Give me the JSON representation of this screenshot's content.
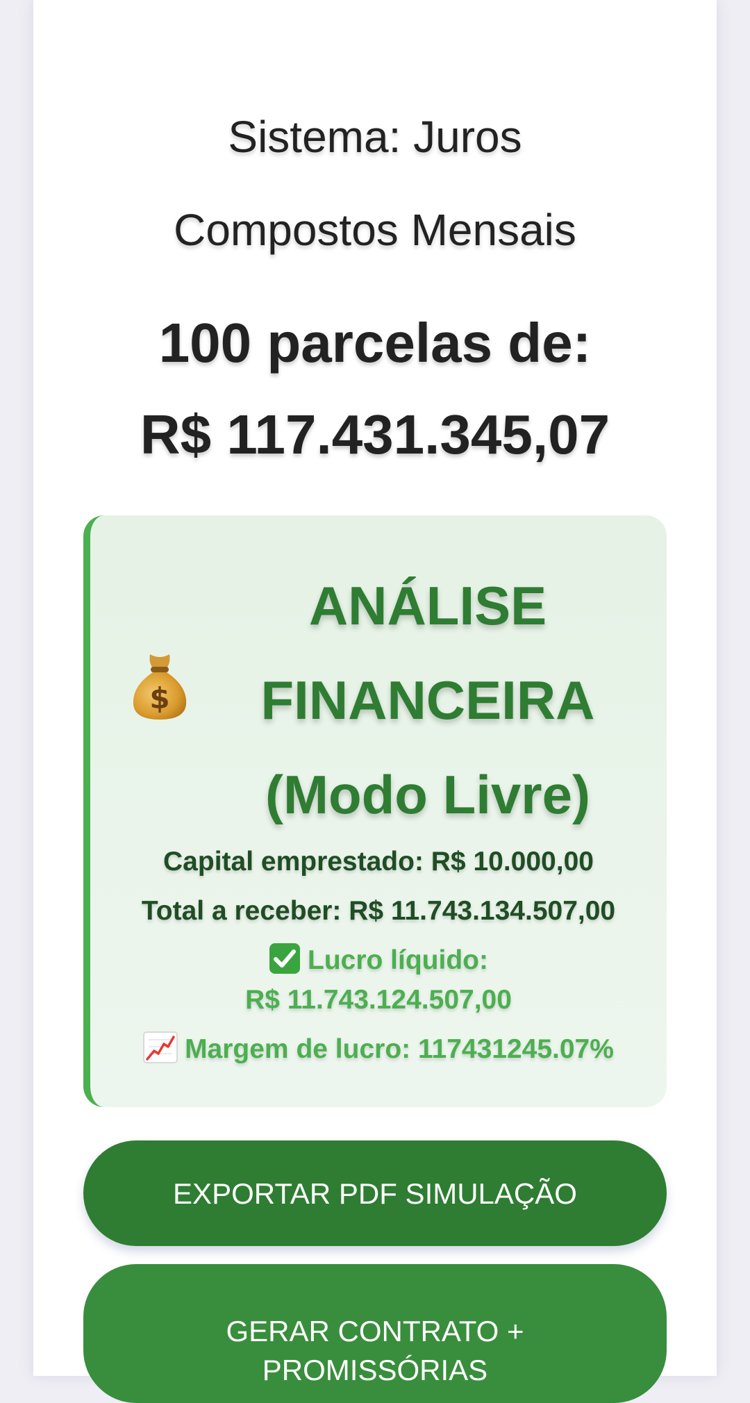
{
  "header": {
    "system_line1": "Sistema: Juros",
    "system_line2": "Compostos Mensais",
    "installments_line1": "100 parcelas de:",
    "installments_line2": "R$ 117.431.345,07"
  },
  "analysis": {
    "title_line1": "ANÁLISE",
    "title_line2": "FINANCEIRA",
    "title_line3": "(Modo Livre)",
    "icon": "money-bag-icon",
    "capital": "Capital emprestado: R$ 10.000,00",
    "total": "Total a receber: R$ 11.743.134.507,00",
    "profit_label": "Lucro líquido:",
    "profit_value": "R$ 11.743.124.507,00",
    "margin": "Margem de lucro: 117431245.07%",
    "colors": {
      "accent": "#4caf50",
      "title": "#2e7d32",
      "dark_text": "#1f4d24",
      "background": "#e6f2e6"
    }
  },
  "actions": {
    "export_label": "EXPORTAR PDF SIMULAÇÃO",
    "contract_line1": "GERAR CONTRATO +",
    "contract_line2": "PROMISSÓRIAS",
    "colors": {
      "export": "#2e7d32",
      "contract": "#388e3c"
    }
  }
}
